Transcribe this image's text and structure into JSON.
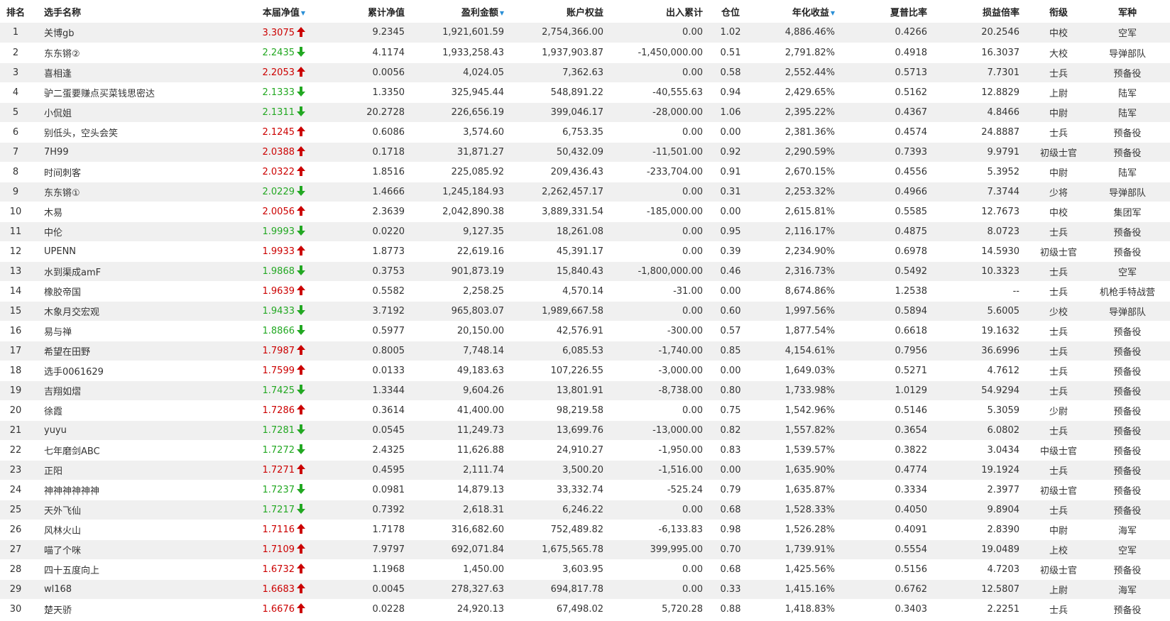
{
  "columns": {
    "rank": "排名",
    "name": "选手名称",
    "nav": "本届净值",
    "cum_nav": "累计净值",
    "profit": "盈利金额",
    "equity": "账户权益",
    "flow": "出入累计",
    "position": "仓位",
    "annual": "年化收益",
    "sharpe": "夏普比率",
    "plr": "损益倍率",
    "title": "衔级",
    "branch": "军种"
  },
  "sort_indicator": "▼",
  "colors": {
    "up": "#cc0000",
    "down": "#22a822",
    "sort": "#2a8fd6",
    "zebra": "#f0f0f0"
  },
  "rows": [
    {
      "rank": "1",
      "name": "关博gb",
      "nav": "3.3075",
      "dir": "up",
      "cum_nav": "9.2345",
      "profit": "1,921,601.59",
      "equity": "2,754,366.00",
      "flow": "0.00",
      "position": "1.02",
      "annual": "4,886.46%",
      "sharpe": "0.4266",
      "plr": "20.2546",
      "title": "中校",
      "branch": "空军"
    },
    {
      "rank": "2",
      "name": "东东锵②",
      "nav": "2.2435",
      "dir": "down",
      "cum_nav": "4.1174",
      "profit": "1,933,258.43",
      "equity": "1,937,903.87",
      "flow": "-1,450,000.00",
      "position": "0.51",
      "annual": "2,791.82%",
      "sharpe": "0.4918",
      "plr": "16.3037",
      "title": "大校",
      "branch": "导弹部队"
    },
    {
      "rank": "3",
      "name": "喜相逢",
      "nav": "2.2053",
      "dir": "up",
      "cum_nav": "0.0056",
      "profit": "4,024.05",
      "equity": "7,362.63",
      "flow": "0.00",
      "position": "0.58",
      "annual": "2,552.44%",
      "sharpe": "0.5713",
      "plr": "7.7301",
      "title": "士兵",
      "branch": "预备役"
    },
    {
      "rank": "4",
      "name": "驴二蛋要赚点买菜钱思密达",
      "nav": "2.1333",
      "dir": "down",
      "cum_nav": "1.3350",
      "profit": "325,945.44",
      "equity": "548,891.22",
      "flow": "-40,555.63",
      "position": "0.94",
      "annual": "2,429.65%",
      "sharpe": "0.5162",
      "plr": "12.8829",
      "title": "上尉",
      "branch": "陆军"
    },
    {
      "rank": "5",
      "name": "小侃姐",
      "nav": "2.1311",
      "dir": "down",
      "cum_nav": "20.2728",
      "profit": "226,656.19",
      "equity": "399,046.17",
      "flow": "-28,000.00",
      "position": "1.06",
      "annual": "2,395.22%",
      "sharpe": "0.4367",
      "plr": "4.8466",
      "title": "中尉",
      "branch": "陆军"
    },
    {
      "rank": "6",
      "name": "别低头，空头会笑",
      "nav": "2.1245",
      "dir": "up",
      "cum_nav": "0.6086",
      "profit": "3,574.60",
      "equity": "6,753.35",
      "flow": "0.00",
      "position": "0.00",
      "annual": "2,381.36%",
      "sharpe": "0.4574",
      "plr": "24.8887",
      "title": "士兵",
      "branch": "预备役"
    },
    {
      "rank": "7",
      "name": "7H99",
      "nav": "2.0388",
      "dir": "up",
      "cum_nav": "0.1718",
      "profit": "31,871.27",
      "equity": "50,432.09",
      "flow": "-11,501.00",
      "position": "0.92",
      "annual": "2,290.59%",
      "sharpe": "0.7393",
      "plr": "9.9791",
      "title": "初级士官",
      "branch": "预备役"
    },
    {
      "rank": "8",
      "name": "时间刺客",
      "nav": "2.0322",
      "dir": "up",
      "cum_nav": "1.8516",
      "profit": "225,085.92",
      "equity": "209,436.43",
      "flow": "-233,704.00",
      "position": "0.91",
      "annual": "2,670.15%",
      "sharpe": "0.4556",
      "plr": "5.3952",
      "title": "中尉",
      "branch": "陆军"
    },
    {
      "rank": "9",
      "name": "东东锵①",
      "nav": "2.0229",
      "dir": "down",
      "cum_nav": "1.4666",
      "profit": "1,245,184.93",
      "equity": "2,262,457.17",
      "flow": "0.00",
      "position": "0.31",
      "annual": "2,253.32%",
      "sharpe": "0.4966",
      "plr": "7.3744",
      "title": "少将",
      "branch": "导弹部队"
    },
    {
      "rank": "10",
      "name": "木易",
      "nav": "2.0056",
      "dir": "up",
      "cum_nav": "2.3639",
      "profit": "2,042,890.38",
      "equity": "3,889,331.54",
      "flow": "-185,000.00",
      "position": "0.00",
      "annual": "2,615.81%",
      "sharpe": "0.5585",
      "plr": "12.7673",
      "title": "中校",
      "branch": "集团军"
    },
    {
      "rank": "11",
      "name": "中伦",
      "nav": "1.9993",
      "dir": "down",
      "cum_nav": "0.0220",
      "profit": "9,127.35",
      "equity": "18,261.08",
      "flow": "0.00",
      "position": "0.95",
      "annual": "2,116.17%",
      "sharpe": "0.4875",
      "plr": "8.0723",
      "title": "士兵",
      "branch": "预备役"
    },
    {
      "rank": "12",
      "name": "UPENN",
      "nav": "1.9933",
      "dir": "up",
      "cum_nav": "1.8773",
      "profit": "22,619.16",
      "equity": "45,391.17",
      "flow": "0.00",
      "position": "0.39",
      "annual": "2,234.90%",
      "sharpe": "0.6978",
      "plr": "14.5930",
      "title": "初级士官",
      "branch": "预备役"
    },
    {
      "rank": "13",
      "name": "水到渠成amF",
      "nav": "1.9868",
      "dir": "down",
      "cum_nav": "0.3753",
      "profit": "901,873.19",
      "equity": "15,840.43",
      "flow": "-1,800,000.00",
      "position": "0.46",
      "annual": "2,316.73%",
      "sharpe": "0.5492",
      "plr": "10.3323",
      "title": "士兵",
      "branch": "空军"
    },
    {
      "rank": "14",
      "name": "橡胶帝国",
      "nav": "1.9639",
      "dir": "up",
      "cum_nav": "0.5582",
      "profit": "2,258.25",
      "equity": "4,570.14",
      "flow": "-31.00",
      "position": "0.00",
      "annual": "8,674.86%",
      "sharpe": "1.2538",
      "plr": "--",
      "title": "士兵",
      "branch": "机枪手特战营"
    },
    {
      "rank": "15",
      "name": "木象月交宏观",
      "nav": "1.9433",
      "dir": "down",
      "cum_nav": "3.7192",
      "profit": "965,803.07",
      "equity": "1,989,667.58",
      "flow": "0.00",
      "position": "0.60",
      "annual": "1,997.56%",
      "sharpe": "0.5894",
      "plr": "5.6005",
      "title": "少校",
      "branch": "导弹部队"
    },
    {
      "rank": "16",
      "name": "易与禅",
      "nav": "1.8866",
      "dir": "down",
      "cum_nav": "0.5977",
      "profit": "20,150.00",
      "equity": "42,576.91",
      "flow": "-300.00",
      "position": "0.57",
      "annual": "1,877.54%",
      "sharpe": "0.6618",
      "plr": "19.1632",
      "title": "士兵",
      "branch": "预备役"
    },
    {
      "rank": "17",
      "name": "希望在田野",
      "nav": "1.7987",
      "dir": "up",
      "cum_nav": "0.8005",
      "profit": "7,748.14",
      "equity": "6,085.53",
      "flow": "-1,740.00",
      "position": "0.85",
      "annual": "4,154.61%",
      "sharpe": "0.7956",
      "plr": "36.6996",
      "title": "士兵",
      "branch": "预备役"
    },
    {
      "rank": "18",
      "name": "选手0061629",
      "nav": "1.7599",
      "dir": "up",
      "cum_nav": "0.0133",
      "profit": "49,183.63",
      "equity": "107,226.55",
      "flow": "-3,000.00",
      "position": "0.00",
      "annual": "1,649.03%",
      "sharpe": "0.5271",
      "plr": "4.7612",
      "title": "士兵",
      "branch": "预备役"
    },
    {
      "rank": "19",
      "name": "吉翔如熠",
      "nav": "1.7425",
      "dir": "down",
      "cum_nav": "1.3344",
      "profit": "9,604.26",
      "equity": "13,801.91",
      "flow": "-8,738.00",
      "position": "0.80",
      "annual": "1,733.98%",
      "sharpe": "1.0129",
      "plr": "54.9294",
      "title": "士兵",
      "branch": "预备役"
    },
    {
      "rank": "20",
      "name": "徐霞",
      "nav": "1.7286",
      "dir": "up",
      "cum_nav": "0.3614",
      "profit": "41,400.00",
      "equity": "98,219.58",
      "flow": "0.00",
      "position": "0.75",
      "annual": "1,542.96%",
      "sharpe": "0.5146",
      "plr": "5.3059",
      "title": "少尉",
      "branch": "预备役"
    },
    {
      "rank": "21",
      "name": "yuyu",
      "nav": "1.7281",
      "dir": "down",
      "cum_nav": "0.0545",
      "profit": "11,249.73",
      "equity": "13,699.76",
      "flow": "-13,000.00",
      "position": "0.82",
      "annual": "1,557.82%",
      "sharpe": "0.3654",
      "plr": "6.0802",
      "title": "士兵",
      "branch": "预备役"
    },
    {
      "rank": "22",
      "name": "七年磨剑ABC",
      "nav": "1.7272",
      "dir": "down",
      "cum_nav": "2.4325",
      "profit": "11,626.88",
      "equity": "24,910.27",
      "flow": "-1,950.00",
      "position": "0.83",
      "annual": "1,539.57%",
      "sharpe": "0.3822",
      "plr": "3.0434",
      "title": "中级士官",
      "branch": "预备役"
    },
    {
      "rank": "23",
      "name": "正阳",
      "nav": "1.7271",
      "dir": "up",
      "cum_nav": "0.4595",
      "profit": "2,111.74",
      "equity": "3,500.20",
      "flow": "-1,516.00",
      "position": "0.00",
      "annual": "1,635.90%",
      "sharpe": "0.4774",
      "plr": "19.1924",
      "title": "士兵",
      "branch": "预备役"
    },
    {
      "rank": "24",
      "name": "神神神神神神",
      "nav": "1.7237",
      "dir": "down",
      "cum_nav": "0.0981",
      "profit": "14,879.13",
      "equity": "33,332.74",
      "flow": "-525.24",
      "position": "0.79",
      "annual": "1,635.87%",
      "sharpe": "0.3334",
      "plr": "2.3977",
      "title": "初级士官",
      "branch": "预备役"
    },
    {
      "rank": "25",
      "name": "天外飞仙",
      "nav": "1.7217",
      "dir": "down",
      "cum_nav": "0.7392",
      "profit": "2,618.31",
      "equity": "6,246.22",
      "flow": "0.00",
      "position": "0.68",
      "annual": "1,528.33%",
      "sharpe": "0.4050",
      "plr": "9.8904",
      "title": "士兵",
      "branch": "预备役"
    },
    {
      "rank": "26",
      "name": "风林火山",
      "nav": "1.7116",
      "dir": "up",
      "cum_nav": "1.7178",
      "profit": "316,682.60",
      "equity": "752,489.82",
      "flow": "-6,133.83",
      "position": "0.98",
      "annual": "1,526.28%",
      "sharpe": "0.4091",
      "plr": "2.8390",
      "title": "中尉",
      "branch": "海军"
    },
    {
      "rank": "27",
      "name": "喵了个咪",
      "nav": "1.7109",
      "dir": "up",
      "cum_nav": "7.9797",
      "profit": "692,071.84",
      "equity": "1,675,565.78",
      "flow": "399,995.00",
      "position": "0.70",
      "annual": "1,739.91%",
      "sharpe": "0.5554",
      "plr": "19.0489",
      "title": "上校",
      "branch": "空军"
    },
    {
      "rank": "28",
      "name": "四十五度向上",
      "nav": "1.6732",
      "dir": "up",
      "cum_nav": "1.1968",
      "profit": "1,450.00",
      "equity": "3,603.95",
      "flow": "0.00",
      "position": "0.68",
      "annual": "1,425.56%",
      "sharpe": "0.5156",
      "plr": "4.7203",
      "title": "初级士官",
      "branch": "预备役"
    },
    {
      "rank": "29",
      "name": "wl168",
      "nav": "1.6683",
      "dir": "up",
      "cum_nav": "0.0045",
      "profit": "278,327.63",
      "equity": "694,817.78",
      "flow": "0.00",
      "position": "0.33",
      "annual": "1,415.16%",
      "sharpe": "0.6762",
      "plr": "12.5807",
      "title": "上尉",
      "branch": "海军"
    },
    {
      "rank": "30",
      "name": "楚天骄",
      "nav": "1.6676",
      "dir": "up",
      "cum_nav": "0.0228",
      "profit": "24,920.13",
      "equity": "67,498.02",
      "flow": "5,720.28",
      "position": "0.88",
      "annual": "1,418.83%",
      "sharpe": "0.3403",
      "plr": "2.2251",
      "title": "士兵",
      "branch": "预备役"
    }
  ]
}
